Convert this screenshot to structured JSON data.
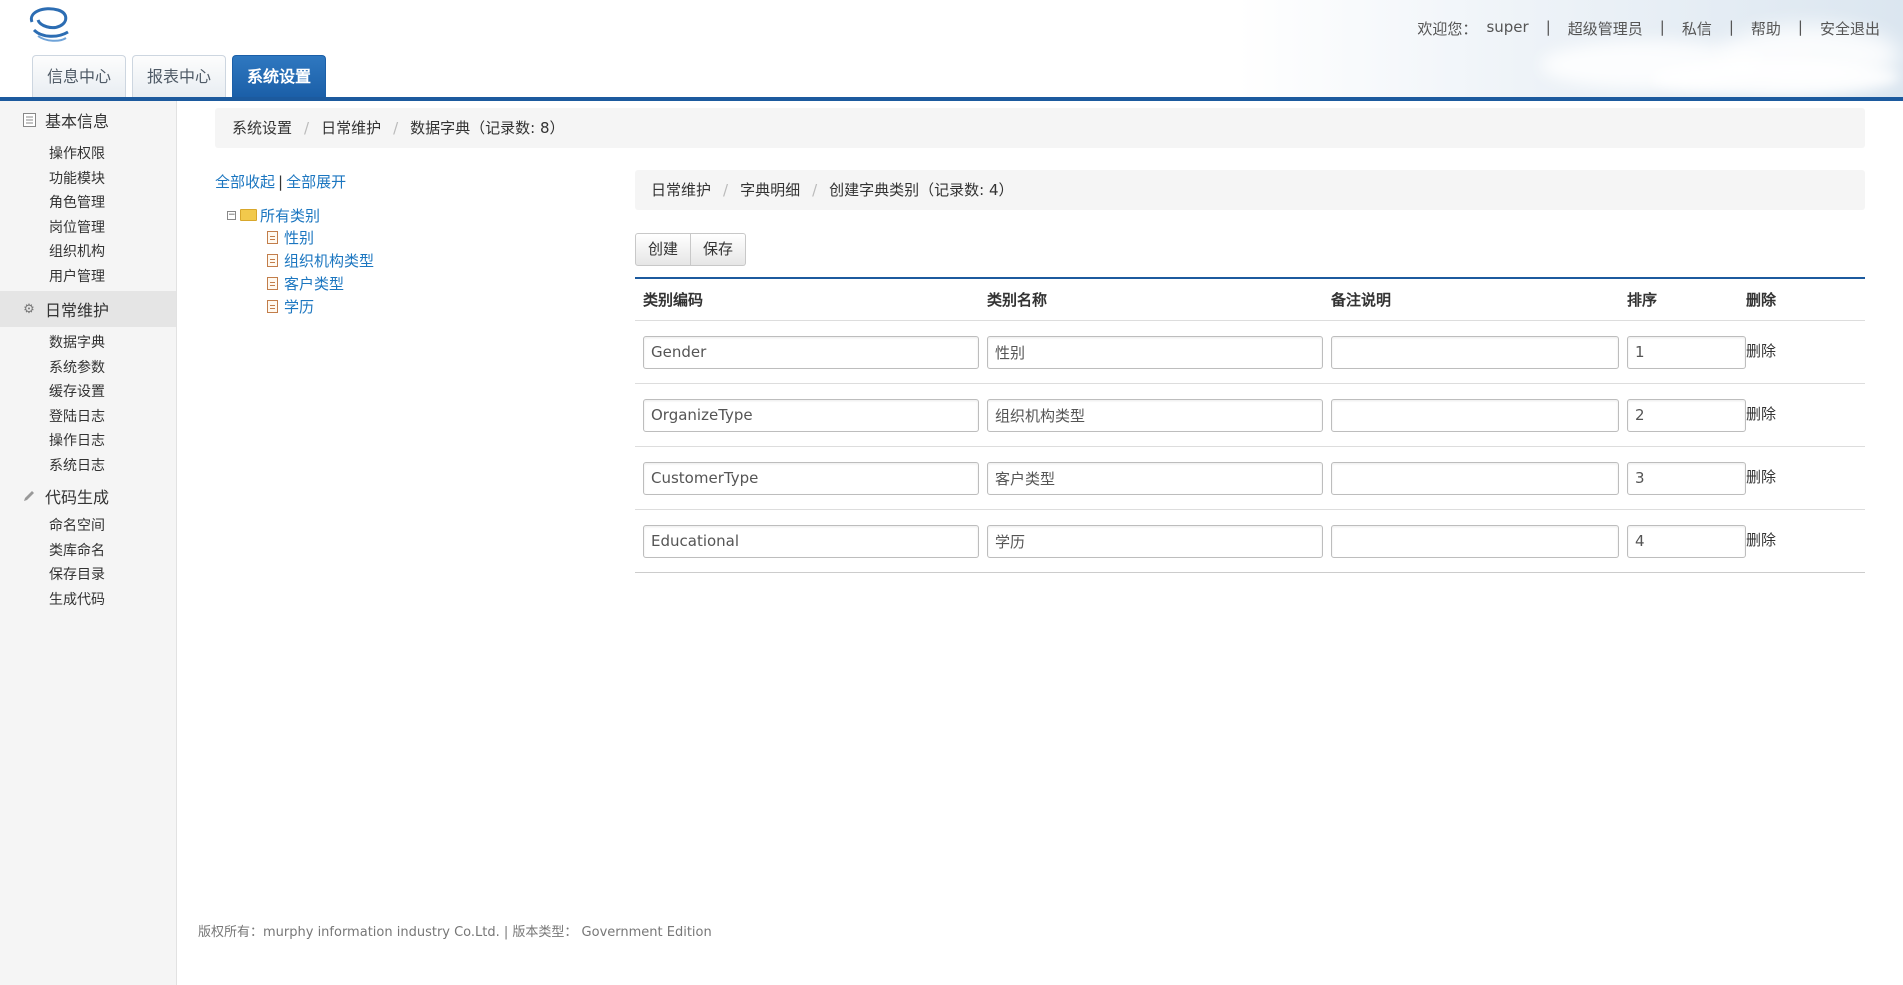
{
  "header": {
    "welcome": "欢迎您：",
    "user": "super",
    "role": "超级管理员",
    "messages": "私信",
    "help": "帮助",
    "logout": "安全退出",
    "tabs": [
      {
        "label": "信息中心"
      },
      {
        "label": "报表中心"
      },
      {
        "label": "系统设置"
      }
    ]
  },
  "sidebar": {
    "groups": [
      {
        "label": "基本信息",
        "icon": "list-icon",
        "items": [
          "操作权限",
          "功能模块",
          "角色管理",
          "岗位管理",
          "组织机构",
          "用户管理"
        ]
      },
      {
        "label": "日常维护",
        "icon": "gear-icon",
        "items": [
          "数据字典",
          "系统参数",
          "缓存设置",
          "登陆日志",
          "操作日志",
          "系统日志"
        ]
      },
      {
        "label": "代码生成",
        "icon": "pencil-icon",
        "items": [
          "命名空间",
          "类库命名",
          "保存目录",
          "生成代码"
        ]
      }
    ]
  },
  "breadcrumb": {
    "a": "系统设置",
    "b": "日常维护",
    "c": "数据字典（记录数: 8）"
  },
  "tree": {
    "collapse_all": "全部收起",
    "expand_all": "全部展开",
    "root": "所有类别",
    "children": [
      "性别",
      "组织机构类型",
      "客户类型",
      "学历"
    ]
  },
  "breadcrumb2": {
    "a": "日常维护",
    "b": "字典明细",
    "c": "创建字典类别（记录数: 4）"
  },
  "toolbar": {
    "create": "创建",
    "save": "保存"
  },
  "grid": {
    "headers": [
      "类别编码",
      "类别名称",
      "备注说明",
      "排序",
      "删除"
    ],
    "rows": [
      {
        "code": "Gender",
        "name": "性别",
        "remark": "",
        "order": "1",
        "del": "删除"
      },
      {
        "code": "OrganizeType",
        "name": "组织机构类型",
        "remark": "",
        "order": "2",
        "del": "删除"
      },
      {
        "code": "CustomerType",
        "name": "客户类型",
        "remark": "",
        "order": "3",
        "del": "删除"
      },
      {
        "code": "Educational",
        "name": "学历",
        "remark": "",
        "order": "4",
        "del": "删除"
      }
    ]
  },
  "footer": "版权所有：murphy information industry Co.Ltd. | 版本类型： Government Edition",
  "colors": {
    "accent": "#1c5a9e",
    "link": "#1b76c0",
    "active_tab": "#1b5fa8"
  }
}
